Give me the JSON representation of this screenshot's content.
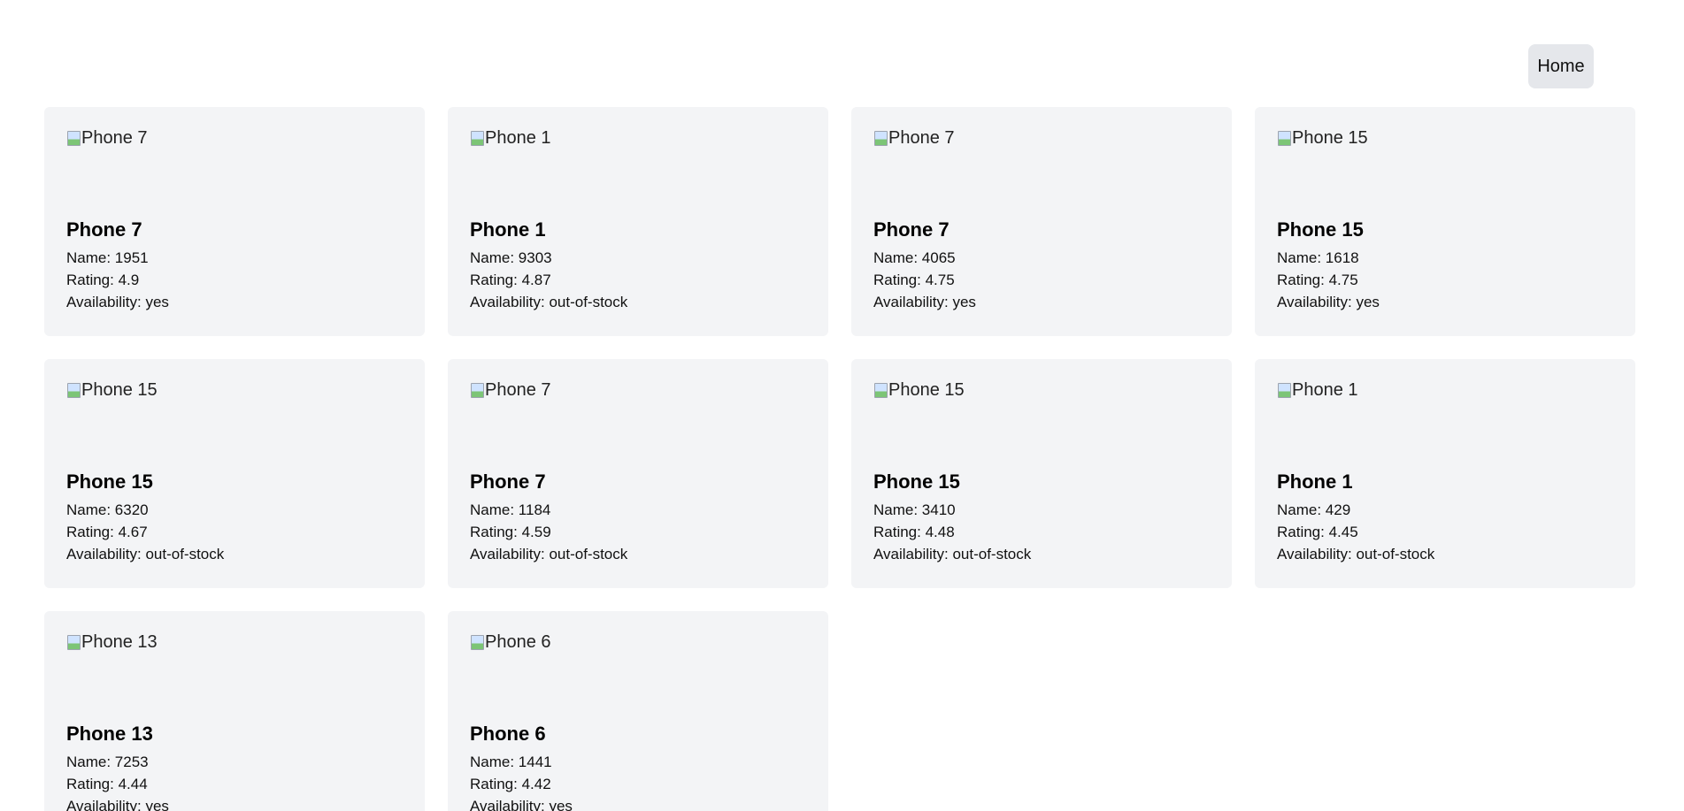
{
  "nav": {
    "home_label": "Home"
  },
  "products": [
    {
      "alt": "Phone 7",
      "title": "Phone 7",
      "name": "Name: 1951",
      "rating": "Rating: 4.9",
      "availability": "Availability: yes"
    },
    {
      "alt": "Phone 1",
      "title": "Phone 1",
      "name": "Name: 9303",
      "rating": "Rating: 4.87",
      "availability": "Availability: out-of-stock"
    },
    {
      "alt": "Phone 7",
      "title": "Phone 7",
      "name": "Name: 4065",
      "rating": "Rating: 4.75",
      "availability": "Availability: yes"
    },
    {
      "alt": "Phone 15",
      "title": "Phone 15",
      "name": "Name: 1618",
      "rating": "Rating: 4.75",
      "availability": "Availability: yes"
    },
    {
      "alt": "Phone 15",
      "title": "Phone 15",
      "name": "Name: 6320",
      "rating": "Rating: 4.67",
      "availability": "Availability: out-of-stock"
    },
    {
      "alt": "Phone 7",
      "title": "Phone 7",
      "name": "Name: 1184",
      "rating": "Rating: 4.59",
      "availability": "Availability: out-of-stock"
    },
    {
      "alt": "Phone 15",
      "title": "Phone 15",
      "name": "Name: 3410",
      "rating": "Rating: 4.48",
      "availability": "Availability: out-of-stock"
    },
    {
      "alt": "Phone 1",
      "title": "Phone 1",
      "name": "Name: 429",
      "rating": "Rating: 4.45",
      "availability": "Availability: out-of-stock"
    },
    {
      "alt": "Phone 13",
      "title": "Phone 13",
      "name": "Name: 7253",
      "rating": "Rating: 4.44",
      "availability": "Availability: yes"
    },
    {
      "alt": "Phone 6",
      "title": "Phone 6",
      "name": "Name: 1441",
      "rating": "Rating: 4.42",
      "availability": "Availability: yes"
    }
  ]
}
